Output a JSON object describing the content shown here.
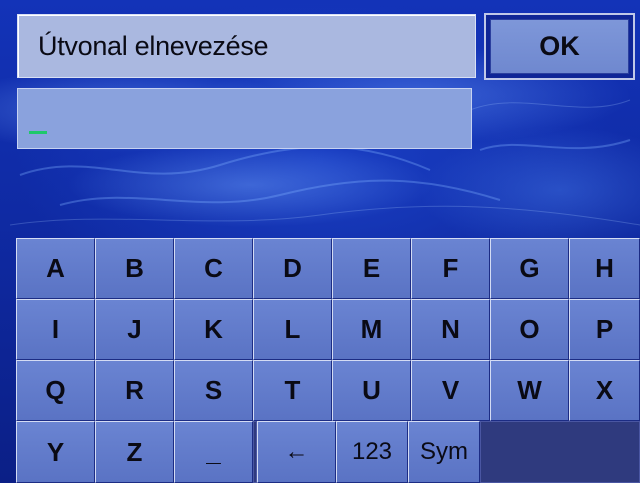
{
  "header": {
    "title": "Útvonal elnevezése",
    "ok_label": "OK"
  },
  "input": {
    "value": ""
  },
  "keyboard": {
    "rows": [
      [
        "A",
        "B",
        "C",
        "D",
        "E",
        "F",
        "G",
        "H"
      ],
      [
        "I",
        "J",
        "K",
        "L",
        "M",
        "N",
        "O",
        "P"
      ],
      [
        "Q",
        "R",
        "S",
        "T",
        "U",
        "V",
        "W",
        "X"
      ],
      [
        "Y",
        "Z",
        "_",
        "←",
        "123",
        "Sym"
      ]
    ]
  },
  "colors": {
    "background": "#1333b8",
    "key": "#6a84d2",
    "title_box": "#aab8e0",
    "input": "#8aa2dd",
    "cursor": "#1ec86a"
  }
}
